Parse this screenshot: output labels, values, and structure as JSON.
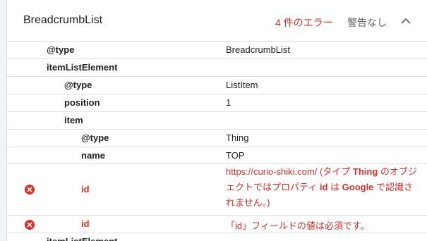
{
  "header": {
    "title": "BreadcrumbList",
    "errors": "4 件のエラー",
    "warnings": "警告なし",
    "collapse_icon": "chevron-up-icon"
  },
  "rows": [
    {
      "key": "@type",
      "value": "BreadcrumbList"
    },
    {
      "key": "itemListElement",
      "value": ""
    },
    {
      "key": "@type",
      "value": "ListItem"
    },
    {
      "key": "position",
      "value": "1"
    },
    {
      "key": "item",
      "value": ""
    },
    {
      "key": "@type",
      "value": "Thing"
    },
    {
      "key": "name",
      "value": "TOP"
    },
    {
      "key": "id",
      "value_parts": {
        "url": "https://curio-shiki.com/",
        "text1": " (タイプ ",
        "type": "Thing",
        "text2": " のオブジェクトではプロパティ ",
        "prop": "id",
        "text3": " は ",
        "google": "Google",
        "text4": " で認識されません。)"
      }
    },
    {
      "key": "id",
      "value": "「id」フィールドの値は必須です。"
    },
    {
      "key": "itemListElement",
      "value": ""
    }
  ],
  "colors": {
    "error": "#d93025",
    "muted": "#5f6368"
  },
  "icons": {
    "error": "error-icon"
  }
}
